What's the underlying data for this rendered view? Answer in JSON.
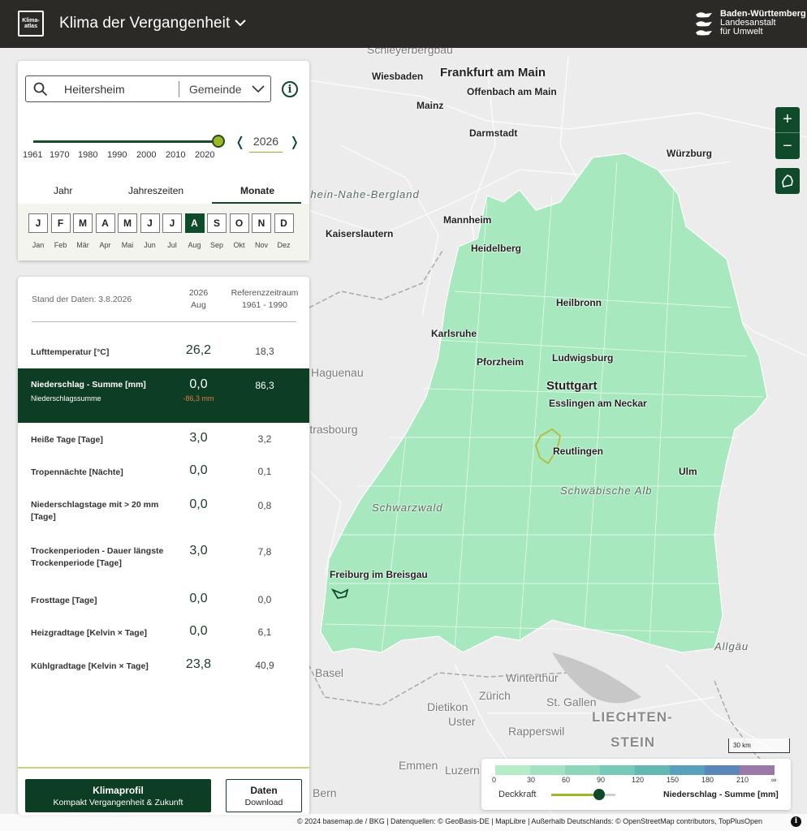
{
  "header": {
    "logo_line1": "Klima-",
    "logo_line2": "atlas",
    "title": "Klima der Vergangenheit",
    "org_line1": "Baden-Württemberg",
    "org_line2": "Landesanstalt",
    "org_line3": "für Umwelt"
  },
  "search": {
    "value": "Heitersheim",
    "type": "Gemeinde"
  },
  "timeline": {
    "ticks": [
      "1961",
      "1970",
      "1980",
      "1990",
      "2000",
      "2010",
      "2020"
    ],
    "year": "2026",
    "prev": "❬",
    "next": "❭"
  },
  "tabs": [
    "Jahr",
    "Jahreszeiten",
    "Monate"
  ],
  "active_tab": "Monate",
  "months": {
    "letters": [
      "J",
      "F",
      "M",
      "A",
      "M",
      "J",
      "J",
      "A",
      "S",
      "O",
      "N",
      "D"
    ],
    "labels": [
      "Jan",
      "Feb",
      "Mär",
      "Apr",
      "Mai",
      "Jun",
      "Jul",
      "Aug",
      "Sep",
      "Okt",
      "Nov",
      "Dez"
    ],
    "active_index": 7
  },
  "data_header": {
    "stand": "Stand der Daten: 3.8.2026",
    "col1_line1": "2026",
    "col1_line2": "Aug",
    "col2_line1": "Referenzzeitraum",
    "col2_line2": "1961 - 1990"
  },
  "rows": [
    {
      "label": "Lufttemperatur [°C]",
      "value": "26,2",
      "ref": "18,3"
    },
    {
      "label": "Niederschlag - Summe [mm]",
      "sub": "Niederschlagssumme",
      "value": "0,0",
      "diff": "-86,3 mm",
      "ref": "86,3",
      "active": true
    },
    {
      "label": "Heiße Tage [Tage]",
      "value": "3,0",
      "ref": "3,2"
    },
    {
      "label": "Tropennächte [Nächte]",
      "value": "0,0",
      "ref": "0,1"
    },
    {
      "label": "Niederschlagstage mit > 20 mm [Tage]",
      "value": "0,0",
      "ref": "0,8"
    },
    {
      "label": "Trockenperioden - Dauer längste Trockenperiode [Tage]",
      "value": "3,0",
      "ref": "7,8"
    },
    {
      "label": "Frosttage [Tage]",
      "value": "0,0",
      "ref": "0,0"
    },
    {
      "label": "Heizgradtage [Kelvin × Tage]",
      "value": "0,0",
      "ref": "6,1"
    },
    {
      "label": "Kühlgradtage [Kelvin × Tage]",
      "value": "23,8",
      "ref": "40,9"
    }
  ],
  "buttons": {
    "profil_title": "Klimaprofil",
    "profil_sub": "Kompakt Vergangenheit & Zukunft",
    "daten_title": "Daten",
    "daten_sub": "Download"
  },
  "map": {
    "cities": [
      {
        "name": "Schleyerbergbau",
        "cls": "gray"
      },
      {
        "name": "Wiesbaden",
        "cls": ""
      },
      {
        "name": "Frankfurt am Main",
        "cls": "big"
      },
      {
        "name": "Mainz",
        "cls": ""
      },
      {
        "name": "Offenbach am Main",
        "cls": ""
      },
      {
        "name": "Darmstadt",
        "cls": ""
      },
      {
        "name": "Würzburg",
        "cls": ""
      },
      {
        "name": "Mannheim",
        "cls": ""
      },
      {
        "name": "Kaiserslautern",
        "cls": ""
      },
      {
        "name": "Heidelberg",
        "cls": ""
      },
      {
        "name": "Heilbronn",
        "cls": ""
      },
      {
        "name": "Karlsruhe",
        "cls": ""
      },
      {
        "name": "Pforzheim",
        "cls": ""
      },
      {
        "name": "Ludwigsburg",
        "cls": ""
      },
      {
        "name": "Stuttgart",
        "cls": "big"
      },
      {
        "name": "Esslingen am Neckar",
        "cls": ""
      },
      {
        "name": "Reutlingen",
        "cls": ""
      },
      {
        "name": "Ulm",
        "cls": ""
      },
      {
        "name": "Schwäbische Alb",
        "cls": "region"
      },
      {
        "name": "Schwarzwald",
        "cls": "region"
      },
      {
        "name": "Freiburg im Breisgau",
        "cls": ""
      },
      {
        "name": "Haguenau",
        "cls": "gray"
      },
      {
        "name": "Allgäu",
        "cls": "region"
      },
      {
        "name": "Basel",
        "cls": "gray"
      },
      {
        "name": "Winterthur",
        "cls": "gray"
      },
      {
        "name": "Zürich",
        "cls": "gray"
      },
      {
        "name": "St. Gallen",
        "cls": "gray"
      },
      {
        "name": "Dietikon",
        "cls": "gray"
      },
      {
        "name": "Uster",
        "cls": "gray"
      },
      {
        "name": "Rapperswil",
        "cls": "gray"
      },
      {
        "name": "Emmen",
        "cls": "gray"
      },
      {
        "name": "Luzern",
        "cls": "gray"
      },
      {
        "name": "Bern",
        "cls": "gray"
      },
      {
        "name": "LIECHTEN-",
        "cls": "bigfaint"
      },
      {
        "name": "STEIN",
        "cls": "bigfaint"
      },
      {
        "name": "Rhein-Nahe-Bergland",
        "cls": "region"
      },
      {
        "name": "Strasbourg",
        "cls": "gray"
      }
    ],
    "scale": "30 km",
    "zoom_in": "+",
    "zoom_out": "−"
  },
  "legend": {
    "colors": [
      "#b7ecc8",
      "#a2e2c3",
      "#8dd6bc",
      "#78cab8",
      "#63b8b1",
      "#5aa0bd",
      "#5a86b8",
      "#9a78a8"
    ],
    "ticks": [
      "0",
      "30",
      "60",
      "90",
      "120",
      "150",
      "180",
      "210",
      "∞"
    ],
    "opacity_label": "Deckkraft",
    "opacity": 0.75,
    "name": "Niederschlag - Summe [mm]"
  },
  "attribution": "© 2024 basemap.de / BKG | Datenquellen: © GeoBasis-DE | MapLibre | Außerhalb Deutschlands: © OpenStreetMap contributors, TopPlusOpen"
}
